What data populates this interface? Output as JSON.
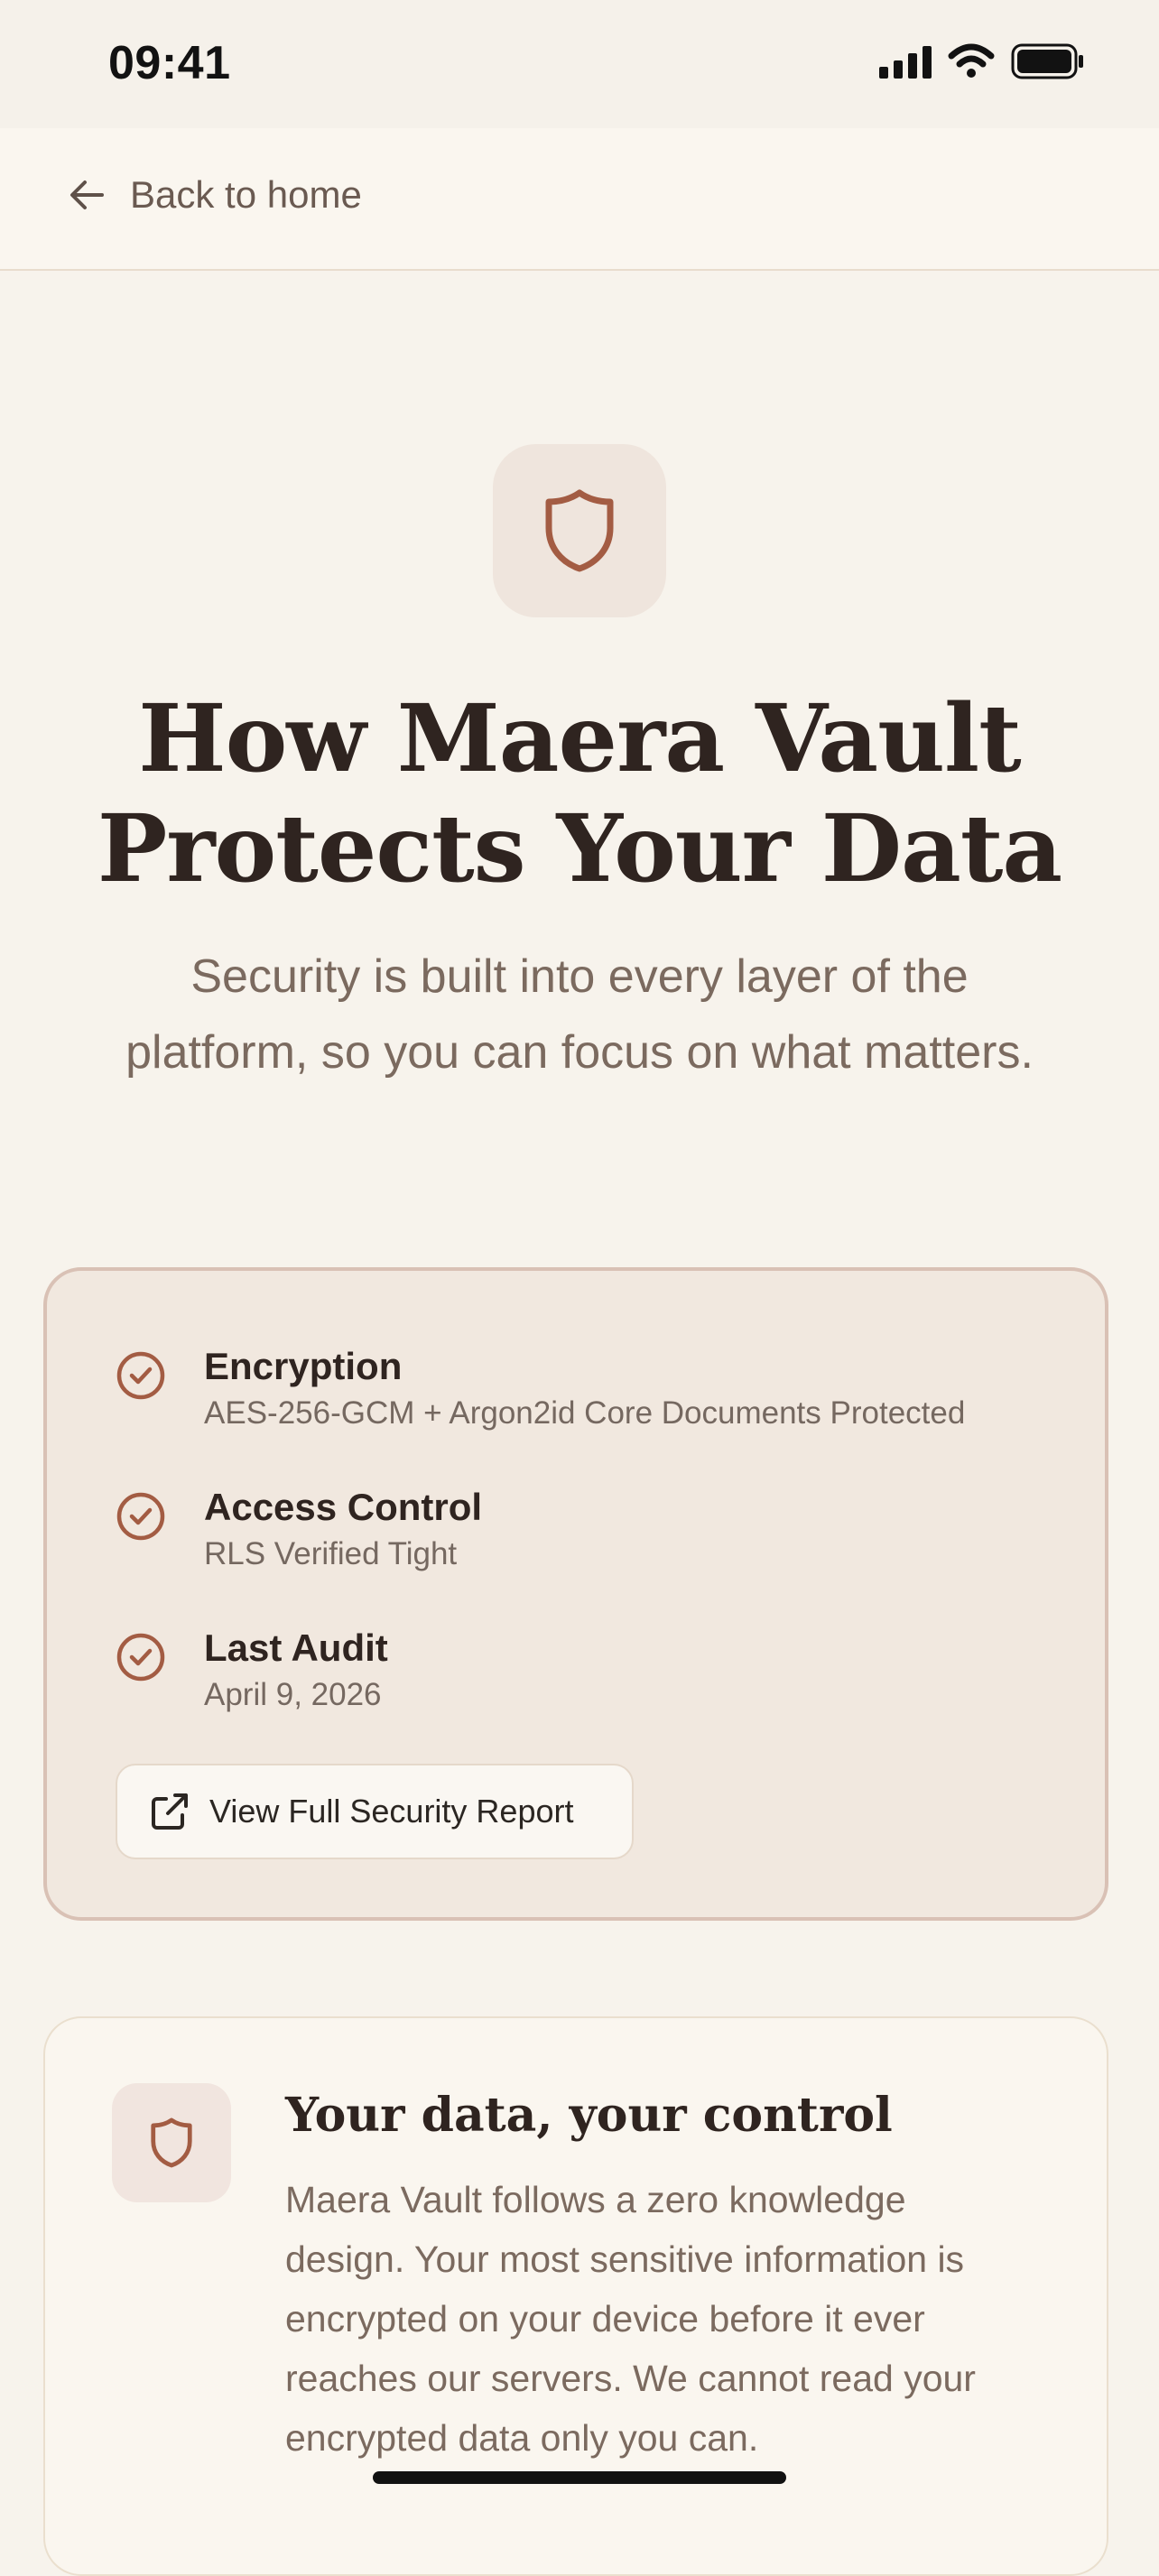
{
  "status_bar": {
    "time": "09:41"
  },
  "header": {
    "back_label": "Back to home"
  },
  "hero": {
    "icon": "shield-icon",
    "title_line1": "How Maera Vault",
    "title_line2": "Protects Your Data",
    "subtitle_line1": "Security is built into every layer of the",
    "subtitle_line2": "platform, so you can focus on what matters."
  },
  "security_summary": {
    "items": [
      {
        "icon": "check-circle-icon",
        "title": "Encryption",
        "value": "AES-256-GCM + Argon2id Core Documents Protected"
      },
      {
        "icon": "check-circle-icon",
        "title": "Access Control",
        "value": "RLS Verified Tight"
      },
      {
        "icon": "check-circle-icon",
        "title": "Last Audit",
        "value": "April 9, 2026"
      }
    ],
    "report_button_label": "View Full Security Report",
    "report_button_icon": "external-link-icon"
  },
  "data_control": {
    "icon": "shield-icon",
    "title": "Your data, your control",
    "text_lines": [
      "Maera Vault follows a zero knowledge",
      "design. Your most sensitive information is",
      "encrypted on your device before it ever",
      "reaches our servers. We cannot read your",
      "encrypted data only you can."
    ]
  },
  "colors": {
    "background": "#f7f3ec",
    "accent": "#a35c43",
    "title_text": "#2f2420",
    "muted_text": "#7b6a5f",
    "security_card_bg": "#f1e8df",
    "security_card_border": "#d9c1b5"
  }
}
